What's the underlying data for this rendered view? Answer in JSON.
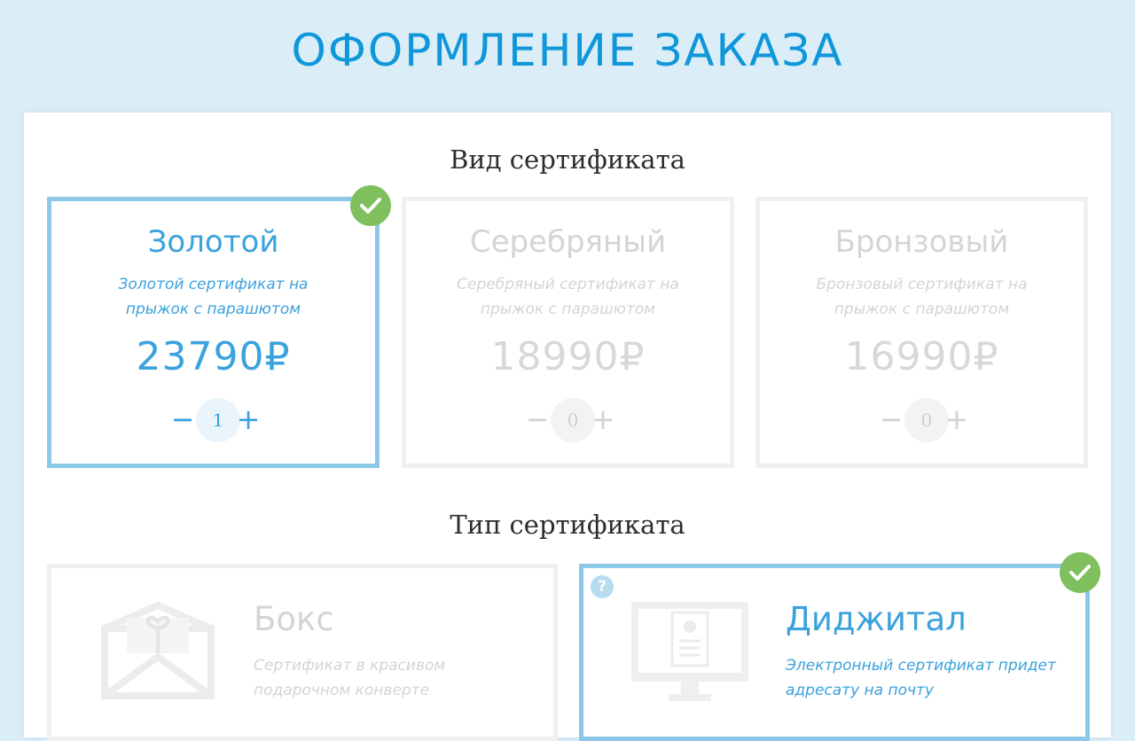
{
  "page": {
    "title": "ОФОРМЛЕНИЕ ЗАКАЗА"
  },
  "kind_section": {
    "title": "Вид сертификата",
    "cards": [
      {
        "name": "Золотой",
        "desc": "Золотой сертификат на прыжок с парашютом",
        "price": "23790₽",
        "qty": "1",
        "selected": true
      },
      {
        "name": "Серебряный",
        "desc": "Серебряный сертификат на прыжок с парашютом",
        "price": "18990₽",
        "qty": "0",
        "selected": false
      },
      {
        "name": "Бронзовый",
        "desc": "Бронзовый сертификат на прыжок с парашютом",
        "price": "16990₽",
        "qty": "0",
        "selected": false
      }
    ]
  },
  "type_section": {
    "title": "Тип сертификата",
    "cards": [
      {
        "name": "Бокс",
        "desc": "Сертификат в красивом подарочном конверте",
        "selected": false,
        "icon": "gift-envelope-icon"
      },
      {
        "name": "Диджитал",
        "desc": "Электронный сертификат придет адресату на почту",
        "selected": true,
        "icon": "monitor-certificate-icon",
        "help": "?"
      }
    ]
  },
  "controls": {
    "minus": "−",
    "plus": "+"
  },
  "colors": {
    "accent": "#3aa2dc",
    "title": "#0f97d9",
    "check": "#7fbf5e",
    "selected_border": "#8cc9e8"
  }
}
